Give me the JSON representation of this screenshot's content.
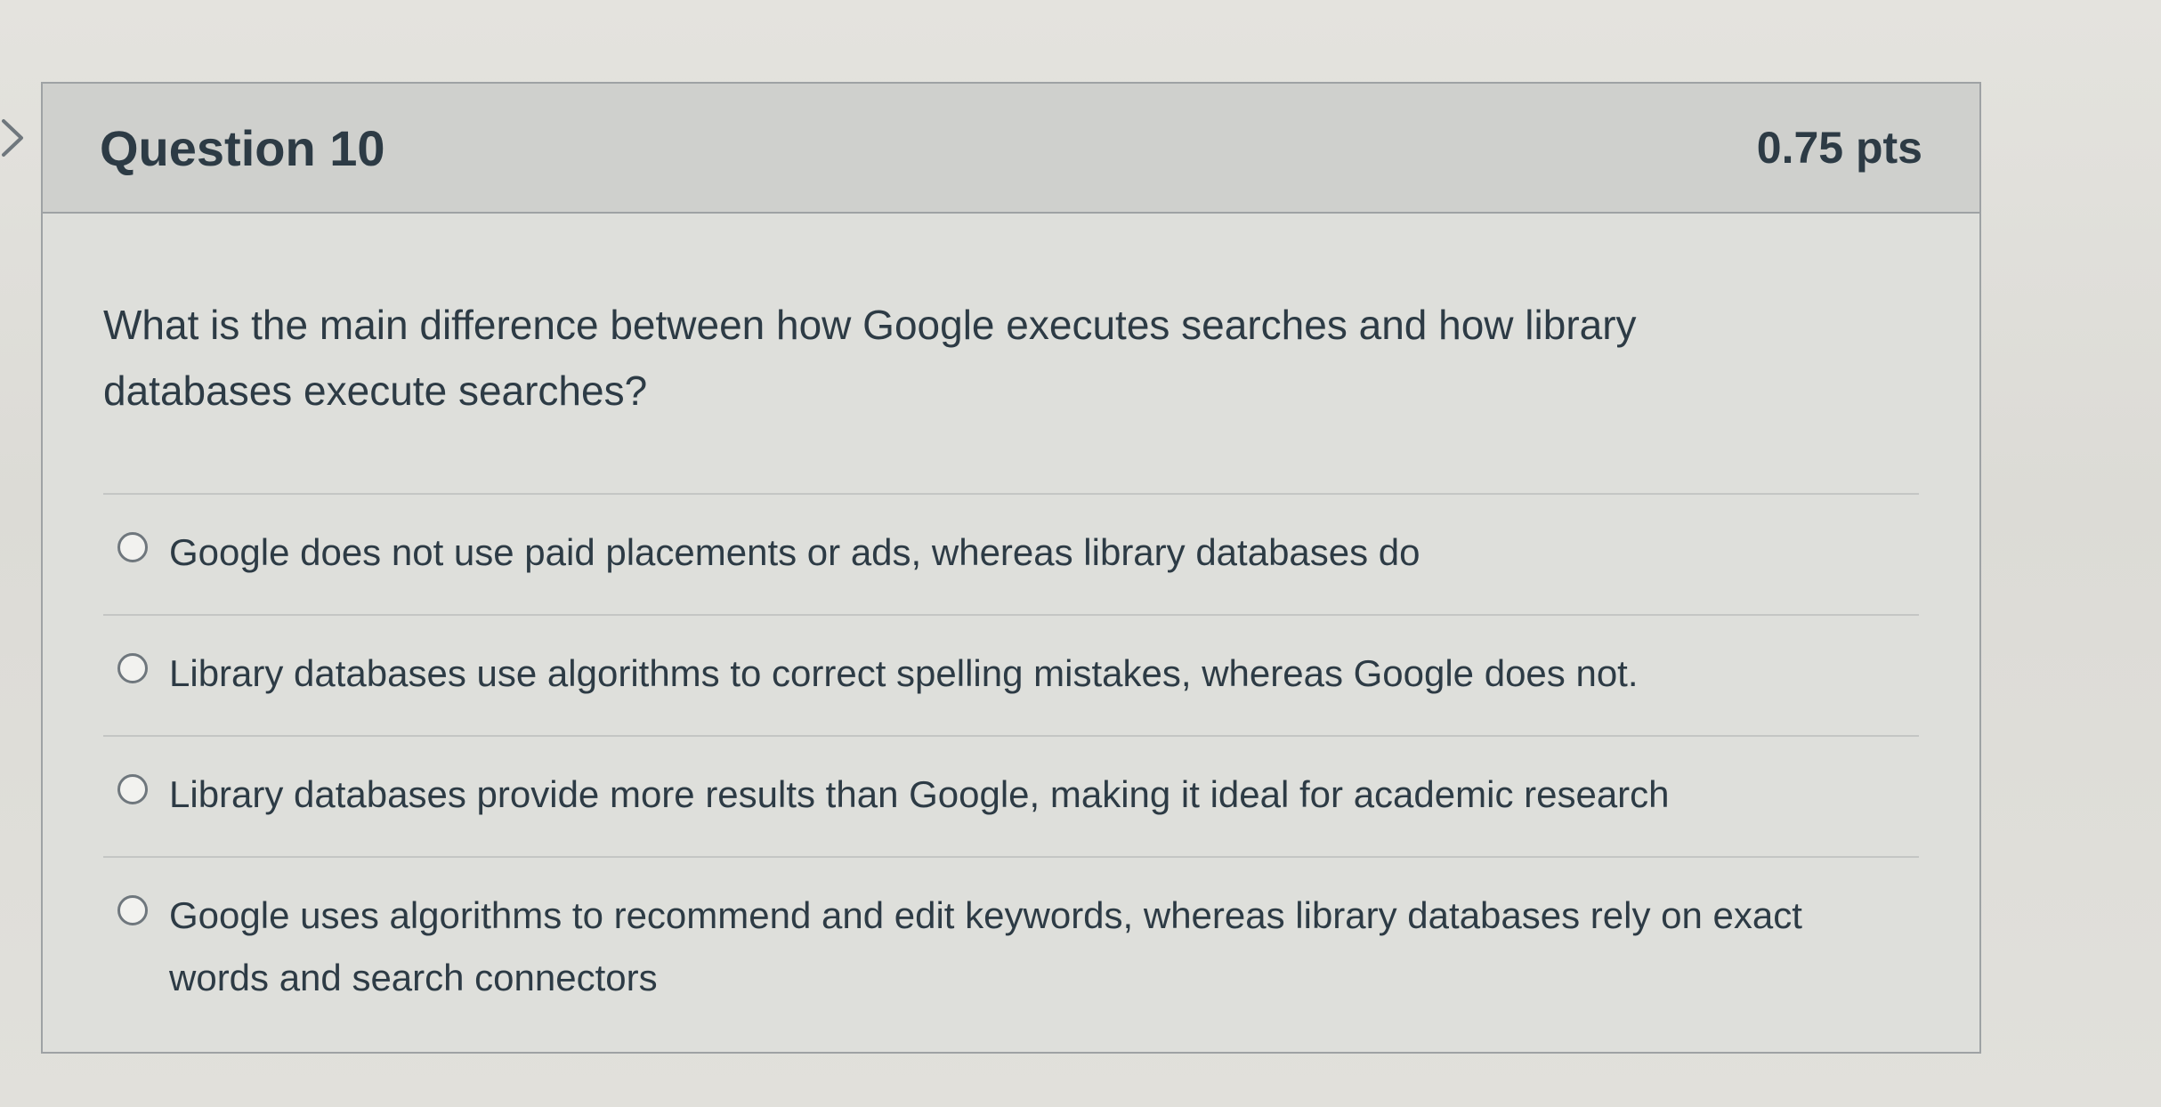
{
  "question": {
    "title": "Question 10",
    "points": "0.75 pts",
    "text": "What is the main difference between how Google executes searches and how library databases execute searches?"
  },
  "answers": [
    {
      "label": "Google does not use paid placements or ads, whereas library databases do"
    },
    {
      "label": "Library databases use algorithms to correct spelling mistakes, whereas Google does not."
    },
    {
      "label": "Library databases provide more results than Google, making it ideal for academic research"
    },
    {
      "label": "Google uses algorithms to recommend and edit keywords, whereas library databases rely on exact words and search connectors"
    }
  ],
  "icons": {
    "nav": "chevron-right-icon",
    "option": "radio-unchecked-icon"
  },
  "colors": {
    "text": "#2d3b45",
    "header_bg": "#cfd0cd",
    "card_bg": "#dedfdb",
    "border": "#9ea2a4"
  }
}
